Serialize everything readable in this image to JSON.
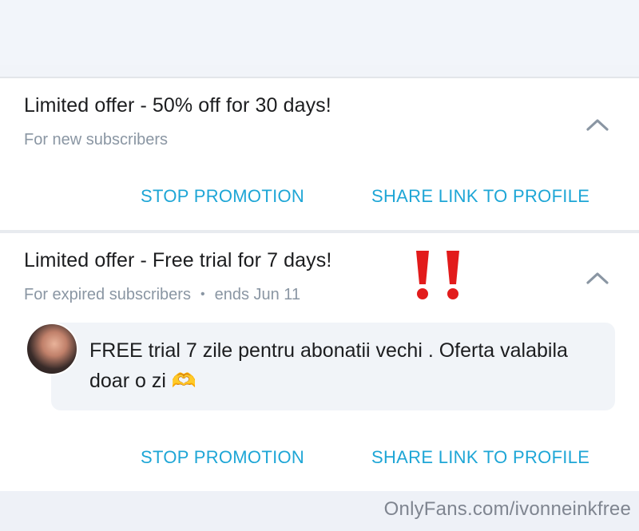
{
  "promotions": [
    {
      "title": "Limited offer - 50% off for 30 days!",
      "audience": "For new subscribers",
      "stop_label": "STOP PROMOTION",
      "share_label": "SHARE LINK TO PROFILE"
    },
    {
      "title": "Limited offer - Free trial for 7 days!",
      "audience": "For expired subscribers",
      "separator": "•",
      "ends": "ends Jun 11",
      "message": "FREE trial 7 zile pentru abonatii vechi . Oferta valabila doar o zi 🫶",
      "stop_label": "STOP PROMOTION",
      "share_label": "SHARE LINK TO PROFILE"
    }
  ],
  "watermark": "OnlyFans.com/ivonneinkfree",
  "colors": {
    "accent": "#1ea6d6",
    "title": "#1c1d1f",
    "muted": "#8a96a3",
    "exclaim": "#e21b1b"
  },
  "icons": {
    "collapse": "chevron-up-icon",
    "alert": "double-exclamation-icon"
  }
}
